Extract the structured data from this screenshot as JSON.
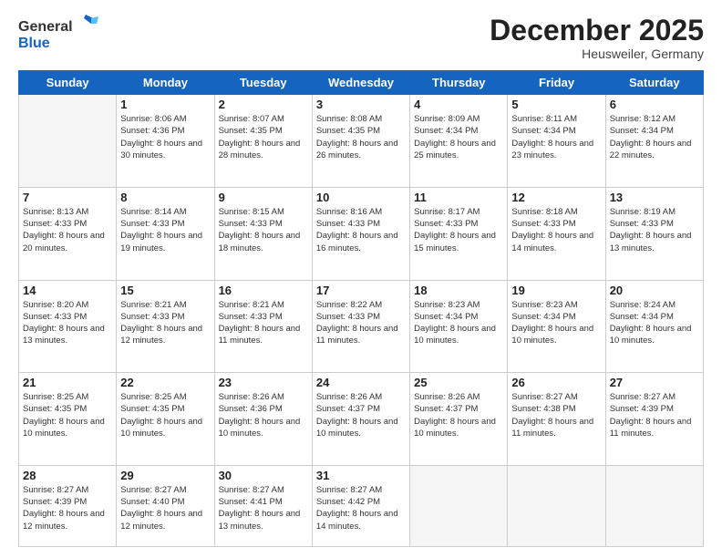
{
  "header": {
    "logo_general": "General",
    "logo_blue": "Blue",
    "month": "December 2025",
    "location": "Heusweiler, Germany"
  },
  "days_of_week": [
    "Sunday",
    "Monday",
    "Tuesday",
    "Wednesday",
    "Thursday",
    "Friday",
    "Saturday"
  ],
  "weeks": [
    [
      {
        "num": "",
        "empty": true
      },
      {
        "num": "1",
        "sunrise": "Sunrise: 8:06 AM",
        "sunset": "Sunset: 4:36 PM",
        "daylight": "Daylight: 8 hours and 30 minutes."
      },
      {
        "num": "2",
        "sunrise": "Sunrise: 8:07 AM",
        "sunset": "Sunset: 4:35 PM",
        "daylight": "Daylight: 8 hours and 28 minutes."
      },
      {
        "num": "3",
        "sunrise": "Sunrise: 8:08 AM",
        "sunset": "Sunset: 4:35 PM",
        "daylight": "Daylight: 8 hours and 26 minutes."
      },
      {
        "num": "4",
        "sunrise": "Sunrise: 8:09 AM",
        "sunset": "Sunset: 4:34 PM",
        "daylight": "Daylight: 8 hours and 25 minutes."
      },
      {
        "num": "5",
        "sunrise": "Sunrise: 8:11 AM",
        "sunset": "Sunset: 4:34 PM",
        "daylight": "Daylight: 8 hours and 23 minutes."
      },
      {
        "num": "6",
        "sunrise": "Sunrise: 8:12 AM",
        "sunset": "Sunset: 4:34 PM",
        "daylight": "Daylight: 8 hours and 22 minutes."
      }
    ],
    [
      {
        "num": "7",
        "sunrise": "Sunrise: 8:13 AM",
        "sunset": "Sunset: 4:33 PM",
        "daylight": "Daylight: 8 hours and 20 minutes."
      },
      {
        "num": "8",
        "sunrise": "Sunrise: 8:14 AM",
        "sunset": "Sunset: 4:33 PM",
        "daylight": "Daylight: 8 hours and 19 minutes."
      },
      {
        "num": "9",
        "sunrise": "Sunrise: 8:15 AM",
        "sunset": "Sunset: 4:33 PM",
        "daylight": "Daylight: 8 hours and 18 minutes."
      },
      {
        "num": "10",
        "sunrise": "Sunrise: 8:16 AM",
        "sunset": "Sunset: 4:33 PM",
        "daylight": "Daylight: 8 hours and 16 minutes."
      },
      {
        "num": "11",
        "sunrise": "Sunrise: 8:17 AM",
        "sunset": "Sunset: 4:33 PM",
        "daylight": "Daylight: 8 hours and 15 minutes."
      },
      {
        "num": "12",
        "sunrise": "Sunrise: 8:18 AM",
        "sunset": "Sunset: 4:33 PM",
        "daylight": "Daylight: 8 hours and 14 minutes."
      },
      {
        "num": "13",
        "sunrise": "Sunrise: 8:19 AM",
        "sunset": "Sunset: 4:33 PM",
        "daylight": "Daylight: 8 hours and 13 minutes."
      }
    ],
    [
      {
        "num": "14",
        "sunrise": "Sunrise: 8:20 AM",
        "sunset": "Sunset: 4:33 PM",
        "daylight": "Daylight: 8 hours and 13 minutes."
      },
      {
        "num": "15",
        "sunrise": "Sunrise: 8:21 AM",
        "sunset": "Sunset: 4:33 PM",
        "daylight": "Daylight: 8 hours and 12 minutes."
      },
      {
        "num": "16",
        "sunrise": "Sunrise: 8:21 AM",
        "sunset": "Sunset: 4:33 PM",
        "daylight": "Daylight: 8 hours and 11 minutes."
      },
      {
        "num": "17",
        "sunrise": "Sunrise: 8:22 AM",
        "sunset": "Sunset: 4:33 PM",
        "daylight": "Daylight: 8 hours and 11 minutes."
      },
      {
        "num": "18",
        "sunrise": "Sunrise: 8:23 AM",
        "sunset": "Sunset: 4:34 PM",
        "daylight": "Daylight: 8 hours and 10 minutes."
      },
      {
        "num": "19",
        "sunrise": "Sunrise: 8:23 AM",
        "sunset": "Sunset: 4:34 PM",
        "daylight": "Daylight: 8 hours and 10 minutes."
      },
      {
        "num": "20",
        "sunrise": "Sunrise: 8:24 AM",
        "sunset": "Sunset: 4:34 PM",
        "daylight": "Daylight: 8 hours and 10 minutes."
      }
    ],
    [
      {
        "num": "21",
        "sunrise": "Sunrise: 8:25 AM",
        "sunset": "Sunset: 4:35 PM",
        "daylight": "Daylight: 8 hours and 10 minutes."
      },
      {
        "num": "22",
        "sunrise": "Sunrise: 8:25 AM",
        "sunset": "Sunset: 4:35 PM",
        "daylight": "Daylight: 8 hours and 10 minutes."
      },
      {
        "num": "23",
        "sunrise": "Sunrise: 8:26 AM",
        "sunset": "Sunset: 4:36 PM",
        "daylight": "Daylight: 8 hours and 10 minutes."
      },
      {
        "num": "24",
        "sunrise": "Sunrise: 8:26 AM",
        "sunset": "Sunset: 4:37 PM",
        "daylight": "Daylight: 8 hours and 10 minutes."
      },
      {
        "num": "25",
        "sunrise": "Sunrise: 8:26 AM",
        "sunset": "Sunset: 4:37 PM",
        "daylight": "Daylight: 8 hours and 10 minutes."
      },
      {
        "num": "26",
        "sunrise": "Sunrise: 8:27 AM",
        "sunset": "Sunset: 4:38 PM",
        "daylight": "Daylight: 8 hours and 11 minutes."
      },
      {
        "num": "27",
        "sunrise": "Sunrise: 8:27 AM",
        "sunset": "Sunset: 4:39 PM",
        "daylight": "Daylight: 8 hours and 11 minutes."
      }
    ],
    [
      {
        "num": "28",
        "sunrise": "Sunrise: 8:27 AM",
        "sunset": "Sunset: 4:39 PM",
        "daylight": "Daylight: 8 hours and 12 minutes."
      },
      {
        "num": "29",
        "sunrise": "Sunrise: 8:27 AM",
        "sunset": "Sunset: 4:40 PM",
        "daylight": "Daylight: 8 hours and 12 minutes."
      },
      {
        "num": "30",
        "sunrise": "Sunrise: 8:27 AM",
        "sunset": "Sunset: 4:41 PM",
        "daylight": "Daylight: 8 hours and 13 minutes."
      },
      {
        "num": "31",
        "sunrise": "Sunrise: 8:27 AM",
        "sunset": "Sunset: 4:42 PM",
        "daylight": "Daylight: 8 hours and 14 minutes."
      },
      {
        "num": "",
        "empty": true
      },
      {
        "num": "",
        "empty": true
      },
      {
        "num": "",
        "empty": true
      }
    ]
  ]
}
